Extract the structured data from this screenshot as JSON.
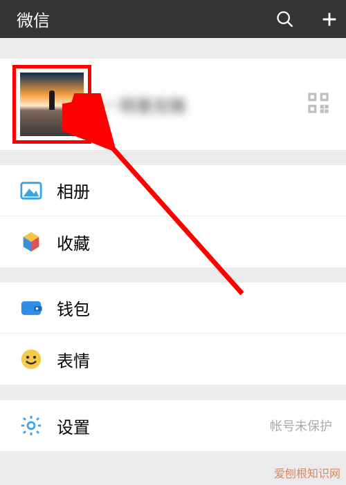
{
  "header": {
    "title": "微信",
    "search_icon": "search-icon",
    "add_icon": "plus-icon"
  },
  "profile": {
    "name_display": "  呀里无随",
    "dash": "—",
    "qr_icon": "qrcode-icon"
  },
  "groups": [
    {
      "items": [
        {
          "label": "相册",
          "icon": "album-icon",
          "note": ""
        },
        {
          "label": "收藏",
          "icon": "favorites-icon",
          "note": ""
        }
      ]
    },
    {
      "items": [
        {
          "label": "钱包",
          "icon": "wallet-icon",
          "note": ""
        },
        {
          "label": "表情",
          "icon": "emoji-icon",
          "note": ""
        }
      ]
    },
    {
      "items": [
        {
          "label": "设置",
          "icon": "settings-icon",
          "note": "帐号未保护"
        }
      ]
    }
  ],
  "watermark": "爱刨根知识网"
}
